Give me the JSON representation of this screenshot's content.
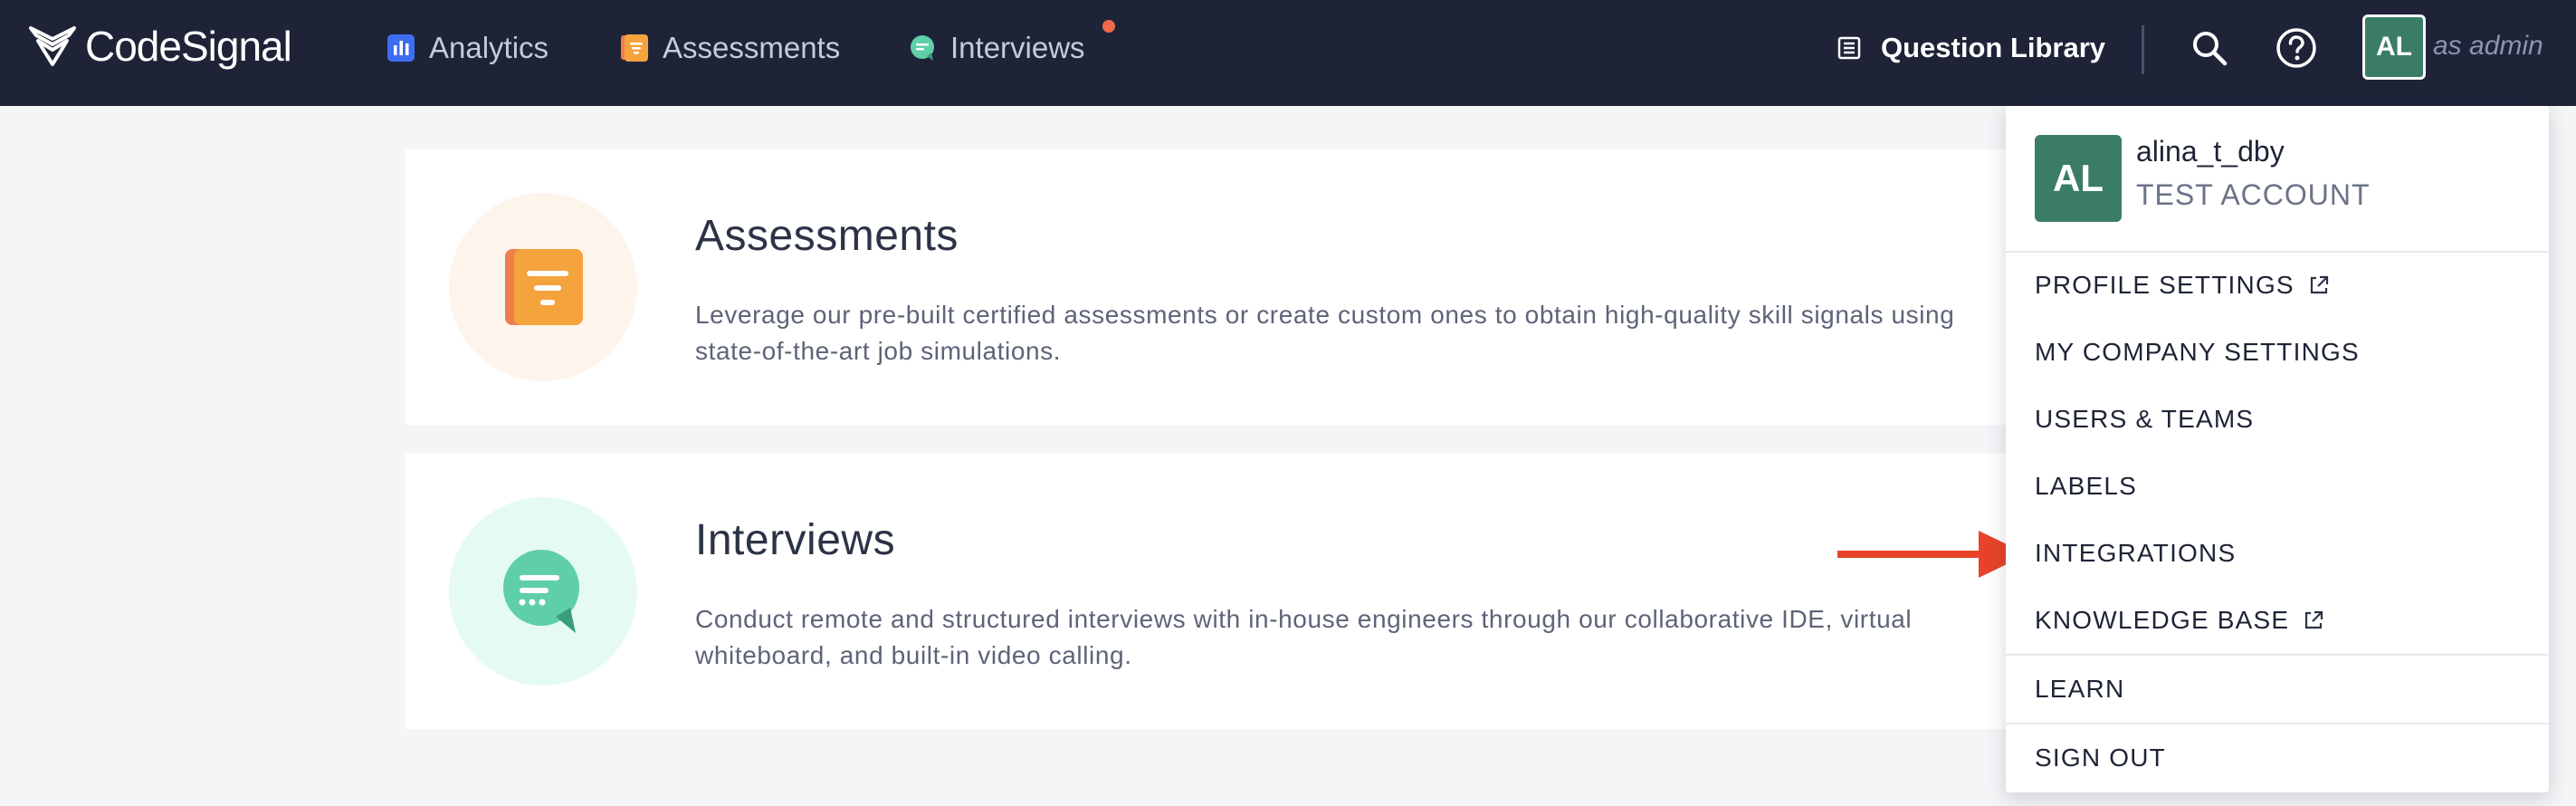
{
  "header": {
    "logo_text": "CodeSignal",
    "nav": [
      {
        "label": "Analytics",
        "icon": "analytics-icon",
        "color": "#3d6ef0"
      },
      {
        "label": "Assessments",
        "icon": "assessments-icon",
        "color": "#f5a33c"
      },
      {
        "label": "Interviews",
        "icon": "interviews-icon",
        "color": "#5fcfa8"
      }
    ],
    "question_library": "Question Library",
    "avatar_initials": "AL",
    "role_text": "as admin"
  },
  "cards": [
    {
      "title": "Assessments",
      "description": "Leverage our pre-built certified assessments or create custom ones to obtain high-quality skill signals using state-of-the-art job simulations."
    },
    {
      "title": "Interviews",
      "description": "Conduct remote and structured interviews with in-house engineers through our collaborative IDE, virtual whiteboard, and built-in video calling."
    }
  ],
  "dropdown": {
    "avatar_initials": "AL",
    "username": "alina_t_dby",
    "account_type": "TEST ACCOUNT",
    "items": [
      {
        "label": "PROFILE SETTINGS"
      },
      {
        "label": "MY COMPANY SETTINGS"
      },
      {
        "label": "USERS & TEAMS"
      },
      {
        "label": "LABELS"
      },
      {
        "label": "INTEGRATIONS"
      },
      {
        "label": "KNOWLEDGE BASE"
      },
      {
        "label": "LEARN"
      },
      {
        "label": "SIGN OUT"
      }
    ]
  },
  "colors": {
    "topbar_bg": "#1e2338",
    "avatar_bg": "#3b7d64",
    "arrow": "#e8432a",
    "notification": "#ef6a4c"
  }
}
